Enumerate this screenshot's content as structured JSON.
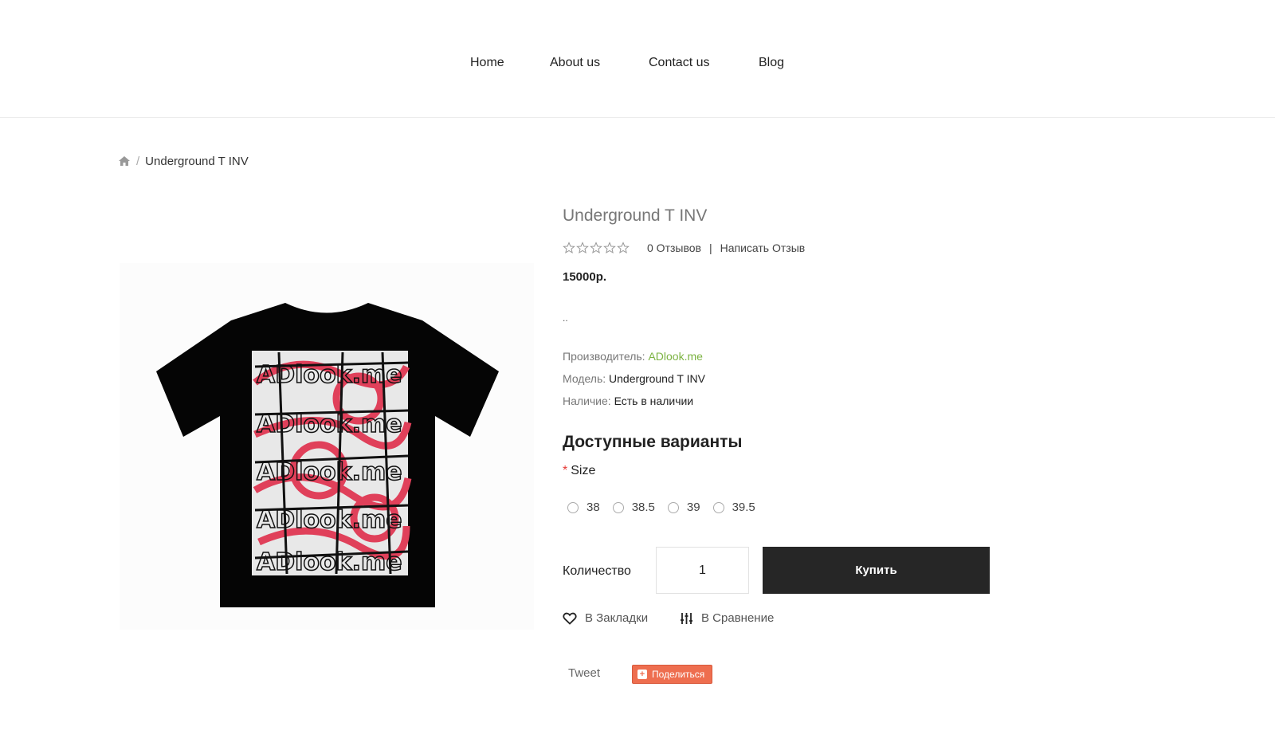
{
  "nav": {
    "items": [
      {
        "label": "Home"
      },
      {
        "label": "About us"
      },
      {
        "label": "Contact us"
      },
      {
        "label": "Blog"
      }
    ]
  },
  "breadcrumb": {
    "home_icon": "home-icon",
    "separator": "/",
    "current": "Underground T INV"
  },
  "product": {
    "title": "Underground T INV",
    "rating": {
      "stars_filled": 0,
      "stars_total": 5,
      "reviews_label": "0 Отзывов",
      "separator": "|",
      "write_review": "Написать Отзыв"
    },
    "price": "15000р.",
    "description": "..",
    "manufacturer": {
      "label": "Производитель:",
      "value": "ADlook.me"
    },
    "model": {
      "label": "Модель:",
      "value": "Underground T INV"
    },
    "availability": {
      "label": "Наличие:",
      "value": "Есть в наличии"
    },
    "image_alt_print_text": "ADlook.me"
  },
  "options": {
    "title": "Доступные варианты",
    "size": {
      "required_mark": "*",
      "label": "Size",
      "values": [
        "38",
        "38.5",
        "39",
        "39.5"
      ]
    }
  },
  "purchase": {
    "quantity_label": "Количество",
    "quantity_value": "1",
    "buy_label": "Купить"
  },
  "actions": {
    "wishlist": {
      "label": "В Закладки",
      "icon": "heart-icon"
    },
    "compare": {
      "label": "В Сравнение",
      "icon": "sliders-icon"
    }
  },
  "social": {
    "tweet": "Tweet",
    "share": "Поделиться"
  },
  "colors": {
    "brand_link": "#7cb342",
    "buy_button": "#262626",
    "share_button": "#ee6e4f",
    "required": "#e53935"
  }
}
